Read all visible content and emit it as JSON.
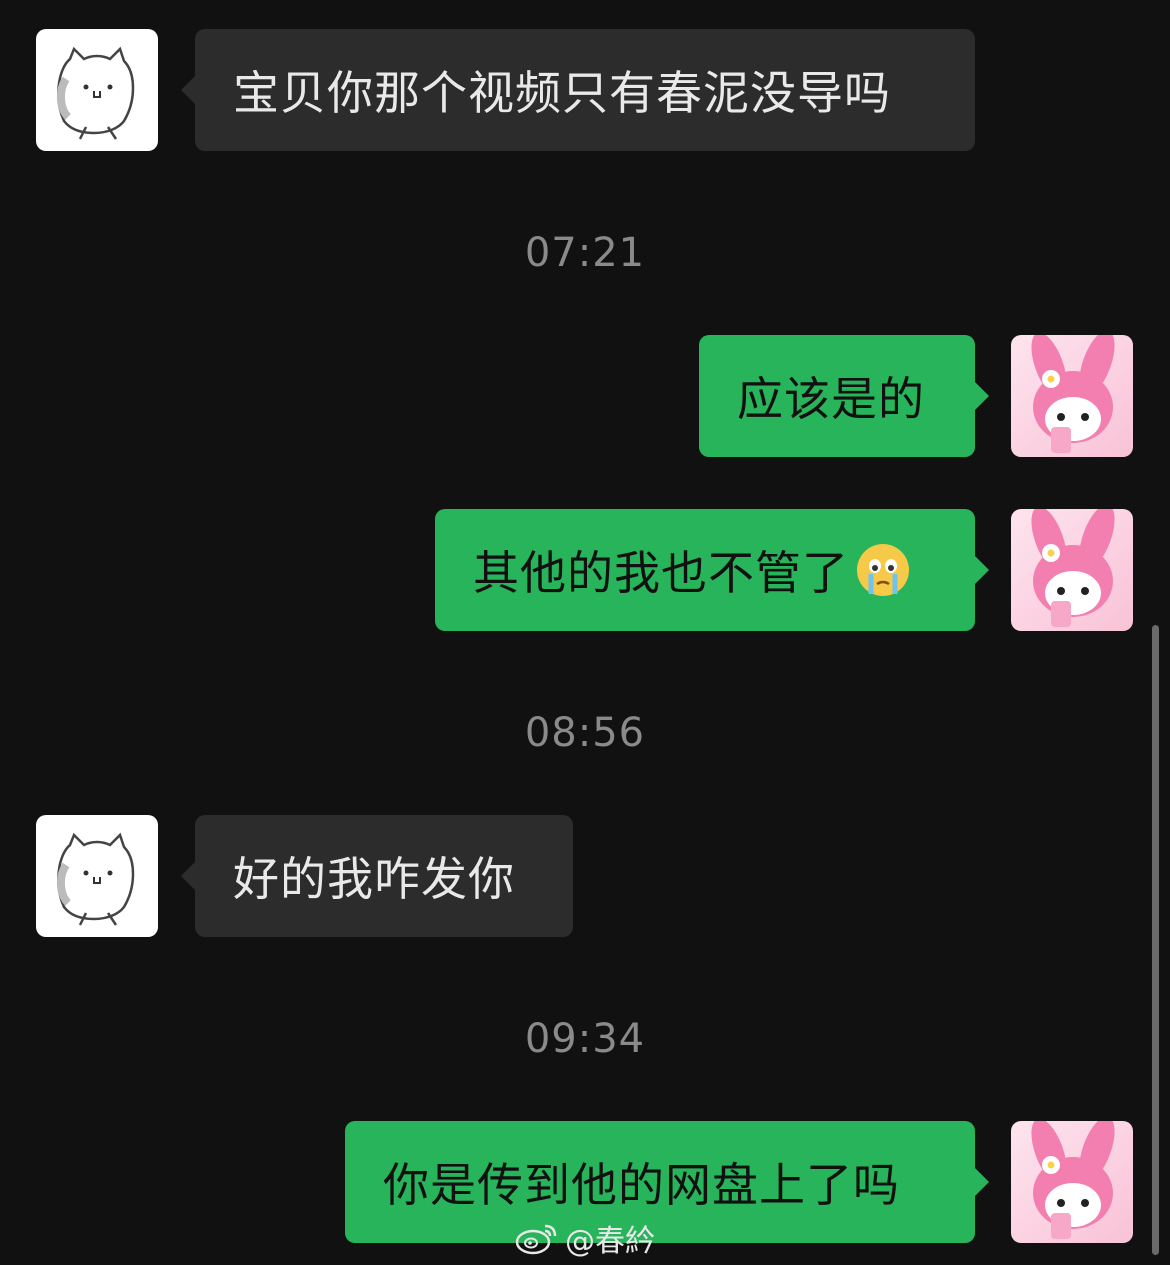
{
  "messages": [
    {
      "text": "宝贝你那个视频只有春泥没导吗"
    },
    {
      "text": "应该是的"
    },
    {
      "text": "其他的我也不管了",
      "emoji": "crying-face-emoji"
    },
    {
      "text": "好的我咋发你"
    },
    {
      "text": "你是传到他的网盘上了吗"
    }
  ],
  "timestamps": [
    "07:21",
    "08:56",
    "09:34"
  ],
  "avatars": {
    "contact": "white-cat-sticker",
    "self": "my-melody-pink-bunny"
  },
  "watermark": {
    "icon": "weibo-icon",
    "text": "@春紟"
  },
  "colors": {
    "background": "#111111",
    "incoming_bubble": "#2c2c2c",
    "outgoing_bubble": "#28b45a",
    "timestamp": "#8a8a8a"
  }
}
